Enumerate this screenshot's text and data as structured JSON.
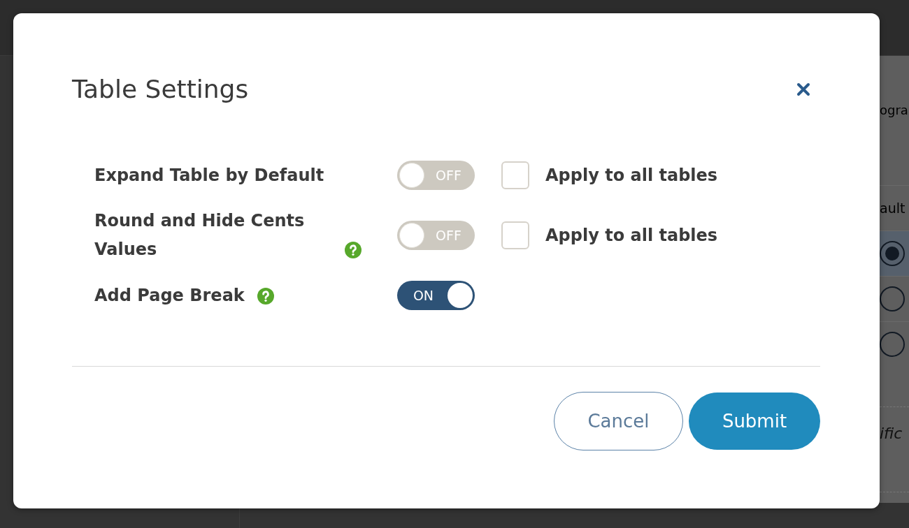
{
  "dialog": {
    "title": "Table Settings",
    "settings": [
      {
        "label": "Expand Table by Default",
        "help": false,
        "toggle": {
          "on": false,
          "text": "OFF"
        },
        "apply_all": {
          "label": "Apply to all tables",
          "checked": false
        }
      },
      {
        "label": "Round and Hide Cents Values",
        "help": true,
        "toggle": {
          "on": false,
          "text": "OFF"
        },
        "apply_all": {
          "label": "Apply to all tables",
          "checked": false
        }
      },
      {
        "label": "Add Page Break",
        "help": true,
        "toggle": {
          "on": true,
          "text": "ON"
        }
      }
    ],
    "buttons": [
      {
        "label": "Cancel",
        "kind": "secondary"
      },
      {
        "label": "Submit",
        "kind": "primary"
      }
    ]
  },
  "background": {
    "heading": "ogra",
    "column_header": "ault",
    "options": [
      {
        "selected": true
      },
      {
        "selected": false
      },
      {
        "selected": false
      }
    ],
    "field": {
      "placeholder": "ific"
    }
  }
}
